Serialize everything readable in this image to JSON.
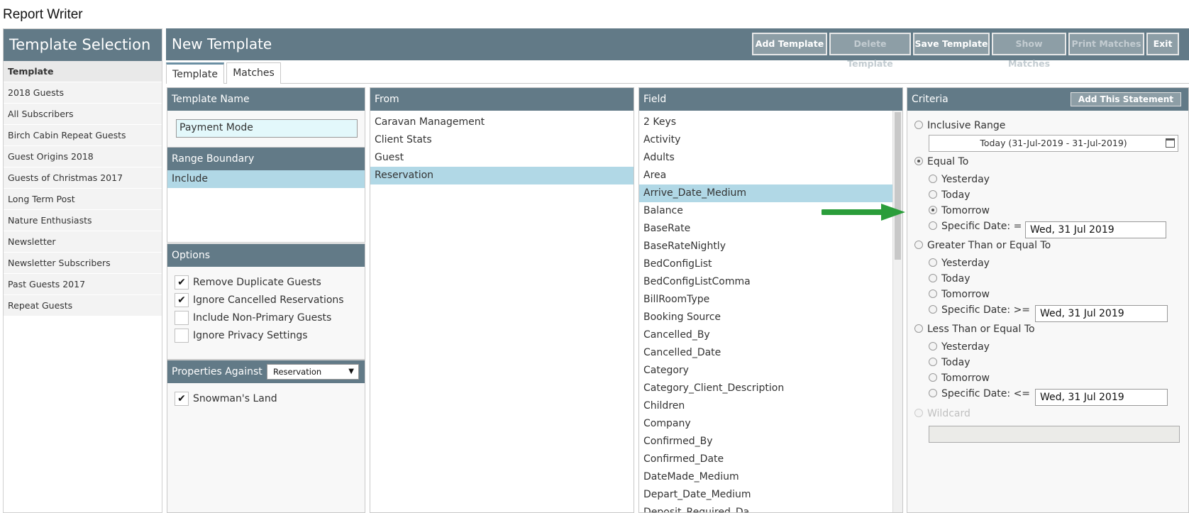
{
  "app_title": "Report Writer",
  "left": {
    "title": "Template Selection",
    "items": [
      "Template",
      "2018 Guests",
      "All Subscribers",
      "Birch Cabin Repeat Guests",
      "Guest Origins 2018",
      "Guests of Christmas 2017",
      "Long Term Post",
      "Nature Enthusiasts",
      "Newsletter",
      "Newsletter Subscribers",
      "Past Guests 2017",
      "Repeat Guests"
    ]
  },
  "header": {
    "title": "New Template",
    "buttons": {
      "add": "Add Template",
      "delete": "Delete Template",
      "save": "Save Template",
      "show": "Show Matches",
      "print": "Print Matches",
      "exit": "Exit"
    }
  },
  "tabs": {
    "template": "Template",
    "matches": "Matches"
  },
  "template_name": {
    "title": "Template Name",
    "value": "Payment Mode"
  },
  "range_boundary": {
    "title": "Range Boundary",
    "value": "Include"
  },
  "options": {
    "title": "Options",
    "items": [
      {
        "label": "Remove Duplicate Guests",
        "checked": true
      },
      {
        "label": "Ignore Cancelled Reservations",
        "checked": true
      },
      {
        "label": "Include Non-Primary Guests",
        "checked": false
      },
      {
        "label": "Ignore Privacy Settings",
        "checked": false
      }
    ]
  },
  "properties": {
    "title": "Properties Against",
    "selected": "Reservation",
    "items": [
      {
        "label": "Snowman's Land",
        "checked": true
      }
    ]
  },
  "from": {
    "title": "From",
    "items": [
      "Caravan Management",
      "Client Stats",
      "Guest",
      "Reservation"
    ],
    "selected": "Reservation"
  },
  "field": {
    "title": "Field",
    "items": [
      "2 Keys",
      "Activity",
      "Adults",
      "Area",
      "Arrive_Date_Medium",
      "Balance",
      "BaseRate",
      "BaseRateNightly",
      "BedConfigList",
      "BedConfigListComma",
      "BillRoomType",
      "Booking Source",
      "Cancelled_By",
      "Cancelled_Date",
      "Category",
      "Category_Client_Description",
      "Children",
      "Company",
      "Confirmed_By",
      "Confirmed_Date",
      "DateMade_Medium",
      "Depart_Date_Medium",
      "Deposit_Required_Da"
    ],
    "selected": "Arrive_Date_Medium"
  },
  "criteria": {
    "title": "Criteria",
    "add_button": "Add This Statement",
    "inclusive_range": "Inclusive Range",
    "range_value": "Today (31-Jul-2019 - 31-Jul-2019)",
    "equal_to": "Equal To",
    "gte": "Greater Than or Equal To",
    "lte": "Less Than or Equal To",
    "wildcard": "Wildcard",
    "yesterday": "Yesterday",
    "today": "Today",
    "tomorrow": "Tomorrow",
    "specific_eq": "Specific Date: =",
    "specific_gte": "Specific Date: >=",
    "specific_lte": "Specific Date: <=",
    "date_value": "Wed, 31 Jul 2019"
  },
  "colors": {
    "header": "#627a87",
    "selected": "#b1d8e6",
    "arrow": "#2a9d3a"
  }
}
